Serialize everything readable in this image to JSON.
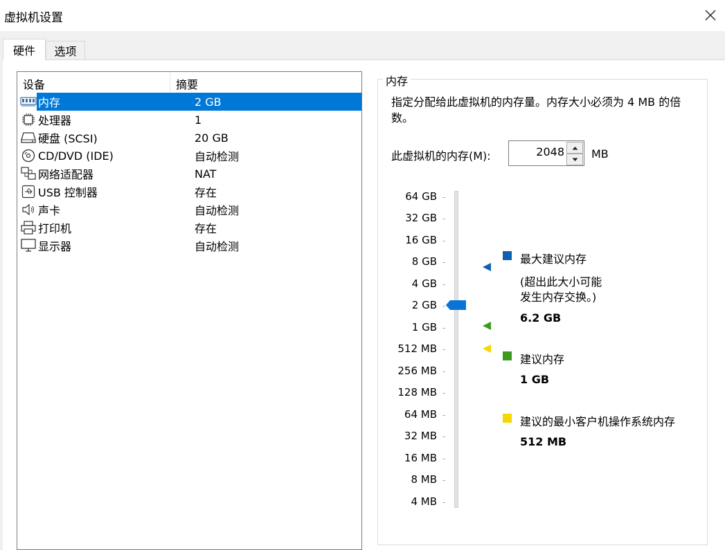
{
  "window": {
    "title": "虚拟机设置"
  },
  "tabs": [
    {
      "label": "硬件"
    },
    {
      "label": "选项"
    }
  ],
  "device_list": {
    "headers": {
      "device": "设备",
      "summary": "摘要"
    },
    "rows": [
      {
        "name": "内存",
        "summary": "2 GB",
        "icon": "memory-icon"
      },
      {
        "name": "处理器",
        "summary": "1",
        "icon": "processor-icon"
      },
      {
        "name": "硬盘 (SCSI)",
        "summary": "20 GB",
        "icon": "harddisk-icon"
      },
      {
        "name": "CD/DVD (IDE)",
        "summary": "自动检测",
        "icon": "cd-icon"
      },
      {
        "name": "网络适配器",
        "summary": "NAT",
        "icon": "network-icon"
      },
      {
        "name": "USB 控制器",
        "summary": "存在",
        "icon": "usb-icon"
      },
      {
        "name": "声卡",
        "summary": "自动检测",
        "icon": "speaker-icon"
      },
      {
        "name": "打印机",
        "summary": "存在",
        "icon": "printer-icon"
      },
      {
        "name": "显示器",
        "summary": "自动检测",
        "icon": "monitor-icon"
      }
    ]
  },
  "memory": {
    "group_title": "内存",
    "description": "指定分配给此虚拟机的内存量。内存大小必须为 4 MB 的倍数。",
    "field_label": "此虚拟机的内存(M):",
    "value": "2048",
    "unit": "MB",
    "scale": [
      "64 GB",
      "32 GB",
      "16 GB",
      "8 GB",
      "4 GB",
      "2 GB",
      "1 GB",
      "512 MB",
      "256 MB",
      "128 MB",
      "64 MB",
      "32 MB",
      "16 MB",
      "8 MB",
      "4 MB"
    ],
    "slider_value": "2 GB",
    "legend": {
      "max": {
        "title": "最大建议内存",
        "note_line1": "(超出此大小可能",
        "note_line2": "发生内存交换。)",
        "value": "6.2 GB",
        "color": "#1060b0"
      },
      "recommended": {
        "title": "建议内存",
        "value": "1 GB",
        "color": "#3a9a1e"
      },
      "min_guest": {
        "title": "建议的最小客户机操作系统内存",
        "value": "512 MB",
        "color": "#f5d800"
      }
    }
  },
  "colors": {
    "selection": "#0078d7"
  }
}
